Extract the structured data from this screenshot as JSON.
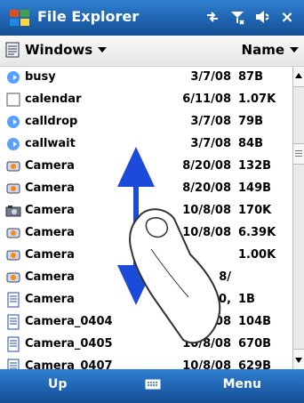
{
  "title_bar": {
    "title": "File Explorer",
    "status_icons": [
      "connectivity-icon",
      "signal-icon",
      "volume-icon",
      "close-icon"
    ],
    "close_label": "×"
  },
  "header": {
    "folder": "Windows",
    "sort": "Name"
  },
  "files": [
    {
      "name": "busy",
      "date": "3/7/08",
      "size": "87B",
      "icon": "audio-icon"
    },
    {
      "name": "calendar",
      "date": "6/11/08",
      "size": "1.07K",
      "icon": "blank-icon"
    },
    {
      "name": "calldrop",
      "date": "3/7/08",
      "size": "79B",
      "icon": "audio-icon"
    },
    {
      "name": "callwait",
      "date": "3/7/08",
      "size": "84B",
      "icon": "audio-icon"
    },
    {
      "name": "Camera",
      "date": "8/20/08",
      "size": "132B",
      "icon": "camera-small-icon"
    },
    {
      "name": "Camera",
      "date": "8/20/08",
      "size": "149B",
      "icon": "camera-small-icon"
    },
    {
      "name": "Camera",
      "date": "10/8/08",
      "size": "170K",
      "icon": "camera-big-icon"
    },
    {
      "name": "Camera",
      "date": "10/8/08",
      "size": "6.39K",
      "icon": "camera-small-icon"
    },
    {
      "name": "Camera",
      "date": "",
      "size": "1.00K",
      "icon": "camera-small-icon"
    },
    {
      "name": "Camera",
      "date": "8/",
      "size": "",
      "icon": "camera-small-icon"
    },
    {
      "name": "Camera",
      "date": "8/20,",
      "size": "1B",
      "icon": "doc-icon"
    },
    {
      "name": "Camera_0404",
      "date": "10/8/08",
      "size": "104B",
      "icon": "doc-icon"
    },
    {
      "name": "Camera_0405",
      "date": "10/8/08",
      "size": "670B",
      "icon": "doc-icon"
    },
    {
      "name": "Camera_0407",
      "date": "10/8/08",
      "size": "629B",
      "icon": "doc-icon"
    }
  ],
  "softkeys": {
    "left": "Up",
    "right": "Menu"
  },
  "colors": {
    "bar_blue": "#1f64b0",
    "gesture_blue": "#1b4bd8",
    "text": "#000000"
  },
  "overlay": {
    "gesture": "vertical-swipe-with-finger"
  }
}
